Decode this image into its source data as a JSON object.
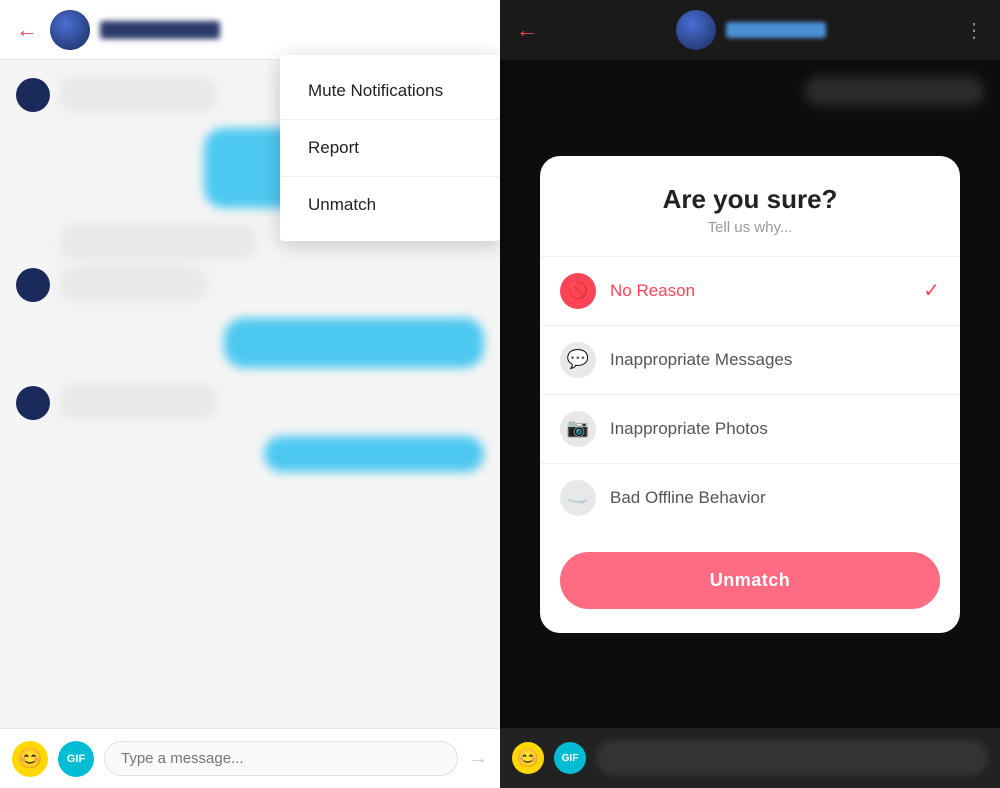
{
  "left_panel": {
    "back_label": "←",
    "dropdown": {
      "mute_label": "Mute Notifications",
      "report_label": "Report",
      "unmatch_label": "Unmatch"
    },
    "chat_input": {
      "placeholder": "Type a message...",
      "send_icon": "→",
      "gif_label": "GIF"
    }
  },
  "right_panel": {
    "back_label": "←",
    "kebab_label": "⋮",
    "modal": {
      "title": "Are you sure?",
      "subtitle": "Tell us why...",
      "options": [
        {
          "id": "no-reason",
          "label": "No Reason",
          "selected": true
        },
        {
          "id": "inappropriate-messages",
          "label": "Inappropriate Messages",
          "selected": false
        },
        {
          "id": "inappropriate-photos",
          "label": "Inappropriate Photos",
          "selected": false
        },
        {
          "id": "bad-offline-behavior",
          "label": "Bad Offline Behavior",
          "selected": false
        }
      ],
      "unmatch_button": "Unmatch"
    },
    "gif_label": "GIF"
  },
  "colors": {
    "accent_red": "#ff4458",
    "accent_blue": "#4dc8f0",
    "accent_teal": "#00bcd4",
    "modal_bg": "white",
    "dark_bg": "#1a1a1a",
    "unmatch_btn": "#ff6b81"
  }
}
